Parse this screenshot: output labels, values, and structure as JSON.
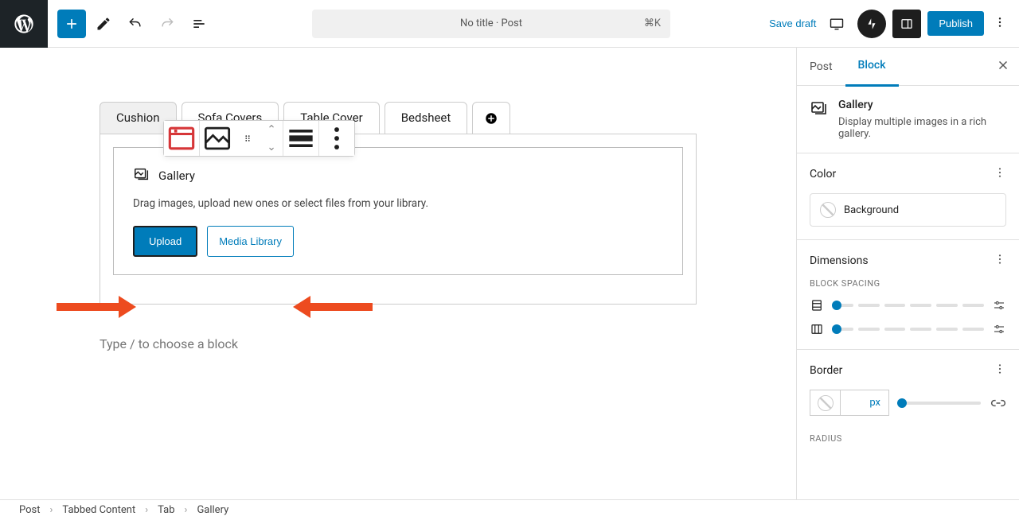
{
  "topbar": {
    "doc_title": "No title · Post",
    "shortcut": "⌘K",
    "save_draft": "Save draft",
    "publish": "Publish"
  },
  "tabs": [
    "Cushion",
    "Sofa Covers",
    "Table Cover",
    "Bedsheet"
  ],
  "gallery": {
    "title": "Gallery",
    "desc": "Drag images, upload new ones or select files from your library.",
    "upload": "Upload",
    "media_library": "Media Library"
  },
  "appender_placeholder": "Type / to choose a block",
  "sidebar": {
    "tab_post": "Post",
    "tab_block": "Block",
    "block_title": "Gallery",
    "block_desc": "Display multiple images in a rich gallery.",
    "color_heading": "Color",
    "color_background": "Background",
    "dimensions_heading": "Dimensions",
    "block_spacing_label": "BLOCK SPACING",
    "border_heading": "Border",
    "border_unit": "px",
    "radius_label": "RADIUS"
  },
  "breadcrumb": [
    "Post",
    "Tabbed Content",
    "Tab",
    "Gallery"
  ],
  "icons": {
    "plus": "plus",
    "pencil": "pencil",
    "undo": "undo",
    "redo": "redo",
    "outline": "outline",
    "preview": "desktop",
    "jetpack": "jetpack",
    "sidebar": "sidebar-toggle",
    "more": "more-vertical",
    "tab_plus": "plus-circle",
    "gallery": "gallery",
    "align": "align",
    "drag": "drag",
    "spacing_v": "spacing-vertical",
    "spacing_h": "spacing-horizontal",
    "settings": "custom-size",
    "link": "link",
    "close": "close"
  }
}
